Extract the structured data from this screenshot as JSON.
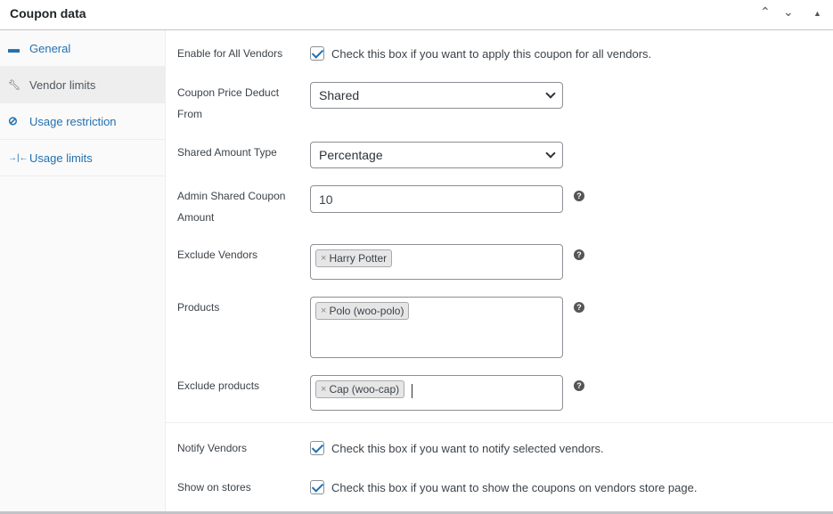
{
  "header": {
    "title": "Coupon data",
    "up": "⌃",
    "down": "⌄",
    "toggle": "▲"
  },
  "sidebar": {
    "items": [
      {
        "label": "General",
        "icon": "ticket-icon",
        "glyph": "▬"
      },
      {
        "label": "Vendor limits",
        "icon": "wrench-icon",
        "glyph": "🔧"
      },
      {
        "label": "Usage restriction",
        "icon": "prohibited-icon",
        "glyph": "⊘"
      },
      {
        "label": "Usage limits",
        "icon": "limits-icon",
        "glyph": "⇥⇤"
      }
    ]
  },
  "fields": {
    "enable_all": {
      "label": "Enable for All Vendors",
      "text": "Check this box if you want to apply this coupon for all vendors.",
      "checked": true
    },
    "deduct_from": {
      "label": "Coupon Price Deduct From",
      "value": "Shared"
    },
    "amount_type": {
      "label": "Shared Amount Type",
      "value": "Percentage"
    },
    "admin_amount": {
      "label": "Admin Shared Coupon Amount",
      "value": "10"
    },
    "exclude_vendors": {
      "label": "Exclude Vendors",
      "chips": [
        "Harry Potter"
      ]
    },
    "products": {
      "label": "Products",
      "chips": [
        "Polo (woo-polo)"
      ]
    },
    "exclude_products": {
      "label": "Exclude products",
      "chips": [
        "Cap (woo-cap)"
      ]
    },
    "notify": {
      "label": "Notify Vendors",
      "text": "Check this box if you want to notify selected vendors.",
      "checked": true
    },
    "show_stores": {
      "label": "Show on stores",
      "text": "Check this box if you want to show the coupons on vendors store page.",
      "checked": true
    }
  },
  "help_glyph": "?",
  "chip_remove": "×"
}
